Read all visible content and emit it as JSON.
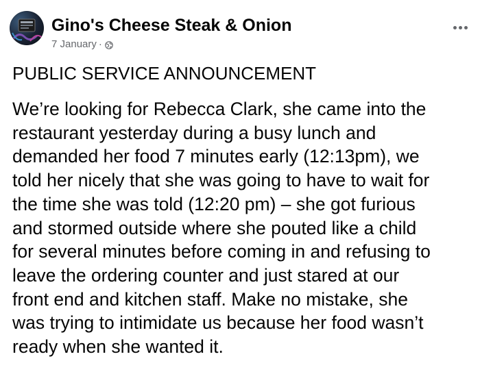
{
  "post": {
    "page_name": "Gino's Cheese Steak & Onion",
    "date": "7 January",
    "separator": "·",
    "audience_icon": "globe-icon",
    "more_icon": "more-options-icon",
    "avatar_icon": "page-avatar",
    "headline": "PUBLIC SERVICE ANNOUNCEMENT",
    "body_lines": [
      "We’re looking for Rebecca Clark, she came into the",
      "restaurant yesterday during a busy lunch and",
      "demanded her food 7 minutes early (12:13pm), we",
      "told her nicely that she was going to have to wait for",
      "the time she was told (12:20 pm) – she got furious",
      "and stormed outside where she pouted like a child",
      "for several minutes before coming in and refusing to",
      "leave the ordering counter and just stared at our",
      "front end and kitchen staff. Make no mistake, she",
      "was trying to intimidate us because her food wasn’t",
      "ready when she wanted it."
    ]
  },
  "colors": {
    "text_primary": "#050505",
    "text_secondary": "#65676b",
    "background": "#ffffff"
  }
}
